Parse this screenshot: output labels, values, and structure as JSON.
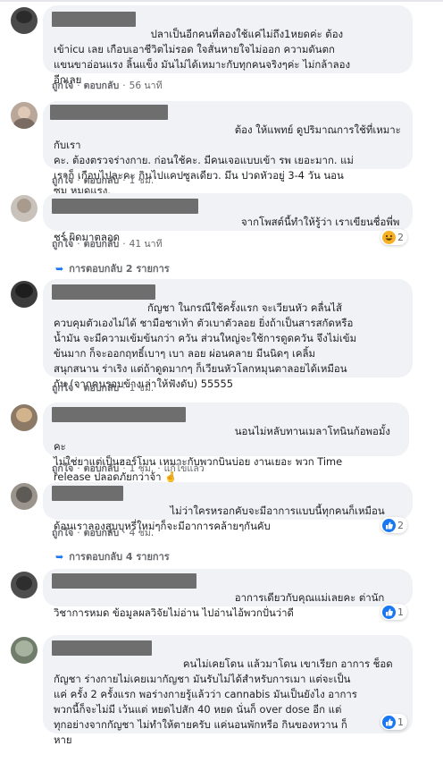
{
  "actions": {
    "like": "ถูกใจ",
    "reply": "ตอบกลับ",
    "edited": "แก้ไขแล้ว",
    "dot": "·"
  },
  "comments": [
    {
      "text": "                          ปลาเป็นอีกคนที่ลองใช้แค่ไม่ถึง1หยดค่ะ ต้อง\nเข้าicu เลย เกือบเอาชีวิตไม่รอด ใจสั่นหายใจไม่ออก ความดันตก\nแขนขาอ่อนแรง ลิ้นแข็ง มันไม่ได้เหมาะกับทุกคนจริงๆค่ะ ไม่กล้าลอง\nอีกเลย",
      "time": "56 นาที"
    },
    {
      "text": "                                                    ต้อง ให้แพทย์ ดูปริมาณการใช้ที่เหมาะกับเรา\nคะ. ต้องตรวจร่างกาย. ก่อนใช้คะ. มีคนเจอแบบเข้า รพ เยอะมาก. แม่\nเราก็ เกือบไปละคะ กินไปแคปซูลเดียว. มึน ปวดหัวอยู่ 3-4 วัน นอน\nซม หมดแรง.",
      "time": "1 ชม."
    },
    {
      "text": "                                                      จากโพสต์นี้ทำให้รู้ว่า เราเขียนชื่อพี่พ\nชร์ ผิดมาตลอด",
      "time": "41 นาที",
      "reaction_count": "2",
      "replies": "การตอบกลับ 2 รายการ"
    },
    {
      "text": "                         กัญชา ในกรณีใช้ครั้งแรก จะเวียนหัว คลื่นไส้\nควบคุมตัวเองไม่ได้ ชามือชาเท้า ตัวเบาตัวลอย ยิ่งถ้าเป็นสารสกัดหรือ\nน้ำมัน จะมีความเข้มข้นกว่า ควัน ส่วนใหญ่จะใช้การดูดควัน จึงไม่เข้ม\nข้นมาก ก็จะออกฤทธิ์เบาๆ เบา ลอย ผ่อนคลาย มีนนิดๆ เคลิ้ม\nสนุกสนาน ร่าเริง แต่ถ้าดูดมากๆ ก็เวียนหัวโลกหมุนตาลอยได้เหมือน\nกัน (จากคนรอบข้างเล่าให้ฟังดับ) 55555",
      "time": "1 ชม."
    },
    {
      "text": "                                                    นอนไม่หลับทานเมลาโทนินก้อพอมั้งคะ\nไม่ใช่ยาแต่เป็นฮอร์โมน เหมาะกับพวกบินบ่อย งานเยอะ พวก Time\nrelease ปลอดภัยกว่าจ้า 🤞",
      "time": "1 ชม.",
      "edited": true
    },
    {
      "text": "                                ไม่ว่าใครหรอกคับจะมีอาการแบบนี้ทุกคนก็เหมือน\nด้อนเราลองสูบบุหรี่ใหม่ๆก็จะมีอาการคล้ายๆกันคับ",
      "time": "4 ชม.",
      "reaction_count": "2",
      "replies": "การตอบกลับ 4 รายการ"
    },
    {
      "text": "                                                    อาการเดียวกับคุณแม่เลยคะ ต่านัก\nวิชาการหมด ข้อมูลผลวิจัยไม่อ่าน ไปอ่านไอ้พวกปั่นว่าดี",
      "time": "",
      "reaction_count": "1"
    },
    {
      "text": "                                    คนไม่เคยโดน แล้วมาโดน เขาเรียก อาการ ช็อด\nกัญชา ร่างกายไม่เคยเมากัญชา มันรับไม่ได้สำหรับการเมา แต่จะเป็น\nแค่ ครั้ง 2 ครั้งแรก พอร่างกายรู้แล้วว่า cannabis มันเป็นยังไง อาการ\nพวกนี้ก็จะไม่มี เว้นแต่ หยดไปสัก 40 หยด นั่นก็ over dose อีก แต่\nทุกอย่างจากกัญชา ไม่ทำให้ตายครับ แค่นอนพักหรือ กินของหวาน ก็\nหาย",
      "time": "",
      "reaction_count": "1"
    }
  ]
}
